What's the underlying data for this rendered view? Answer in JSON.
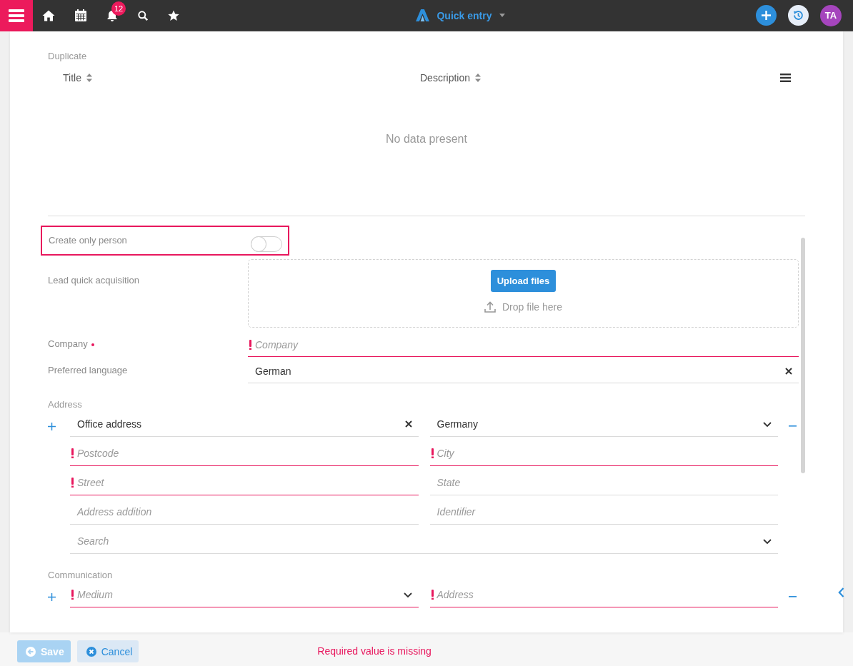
{
  "topbar": {
    "notifications": "12",
    "title": "Quick entry",
    "avatar": "TA"
  },
  "duplicates": {
    "label": "Duplicate",
    "columns": [
      {
        "label": "Title"
      },
      {
        "label": "Description"
      }
    ],
    "empty_text": "No data present"
  },
  "create_only_person": {
    "label": "Create only person",
    "on": false,
    "highlighted": true
  },
  "lead_acquisition": {
    "label": "Lead quick acquisition",
    "button": "Upload files",
    "drop_hint": "Drop file here"
  },
  "fields": [
    {
      "label": "Company",
      "required": true,
      "kind": "text",
      "placeholder": "Company",
      "invalid": true
    },
    {
      "label": "Preferred language",
      "kind": "clearable",
      "value": "German",
      "invalid": false
    }
  ],
  "address": {
    "label": "Address",
    "rows": [
      {
        "fields": [
          {
            "kind": "clearable",
            "value": "Office address",
            "invalid": false
          },
          {
            "kind": "select",
            "value": "Germany",
            "invalid": false
          }
        ]
      },
      {
        "fields": [
          {
            "kind": "text",
            "placeholder": "Postcode",
            "invalid": true
          },
          {
            "kind": "text",
            "placeholder": "City",
            "invalid": true
          }
        ]
      },
      {
        "fields": [
          {
            "kind": "text",
            "placeholder": "Street",
            "invalid": true
          },
          {
            "kind": "text",
            "placeholder": "State",
            "invalid": false
          }
        ]
      },
      {
        "fields": [
          {
            "kind": "text",
            "placeholder": "Address addition",
            "invalid": false
          },
          {
            "kind": "text",
            "placeholder": "Identifier",
            "invalid": false
          }
        ]
      },
      {
        "fields": [
          {
            "kind": "select",
            "placeholder": "Search",
            "invalid": false
          }
        ]
      }
    ]
  },
  "communication": {
    "label": "Communication",
    "rows": [
      {
        "fields": [
          {
            "kind": "select",
            "placeholder": "Medium",
            "invalid": true
          },
          {
            "kind": "text",
            "placeholder": "Address",
            "invalid": true
          }
        ]
      }
    ]
  },
  "footer": {
    "save": {
      "label": "Save",
      "disabled": true
    },
    "cancel": {
      "label": "Cancel"
    },
    "message": "Required value is missing"
  }
}
